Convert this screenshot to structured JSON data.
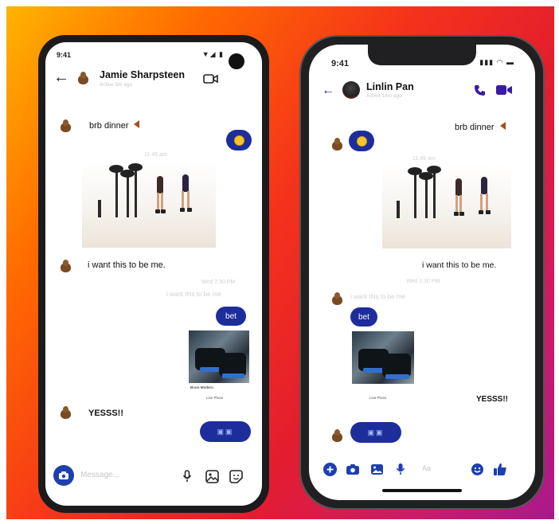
{
  "android": {
    "status_time": "9:41",
    "status_icons": "▼◢ ▮",
    "contact_name": "Jamie Sharpsteen",
    "contact_status": "Active 5m ago",
    "messages": {
      "m1": "brb dinner",
      "timestamp1": "11:49 am",
      "m2": "i want this to be me.",
      "timestamp2": "Wed 2:30 PM",
      "reply_preview": "i want this to be me",
      "m3": "bet",
      "photo_caption1": "Brain Modern",
      "photo_caption2": "Live Photo",
      "m4": "YESSS!!"
    },
    "composer_placeholder": "Message..."
  },
  "iphone": {
    "status_time": "9:41",
    "status_icons": "▮▮▮ ◠ ▬",
    "contact_name": "Linlin Pan",
    "contact_status": "Active 14m ago",
    "messages": {
      "m1": "brb dinner",
      "timestamp1": "11:49 am",
      "m2": "i want this to be me.",
      "timestamp2": "Wed 2:30 PM",
      "reply_preview": "i want this to be me",
      "m3": "bet",
      "photo_caption2": "Live Photo",
      "m4": "YESSS!!"
    },
    "composer_placeholder": "Aa"
  },
  "colors": {
    "messenger_blue": "#1d2d9b",
    "accent_purple": "#3a1aa6",
    "poo_brown": "#7a4a22"
  },
  "icons": {
    "android_header": [
      "back-arrow-icon",
      "video-camera-icon"
    ],
    "android_composer": [
      "camera-icon",
      "microphone-icon",
      "image-icon",
      "sticker-icon"
    ],
    "iphone_header": [
      "back-arrow-icon",
      "phone-icon",
      "video-camera-icon"
    ],
    "iphone_composer": [
      "plus-icon",
      "camera-icon",
      "image-icon",
      "microphone-icon",
      "emoji-icon",
      "thumbs-up-icon"
    ]
  }
}
